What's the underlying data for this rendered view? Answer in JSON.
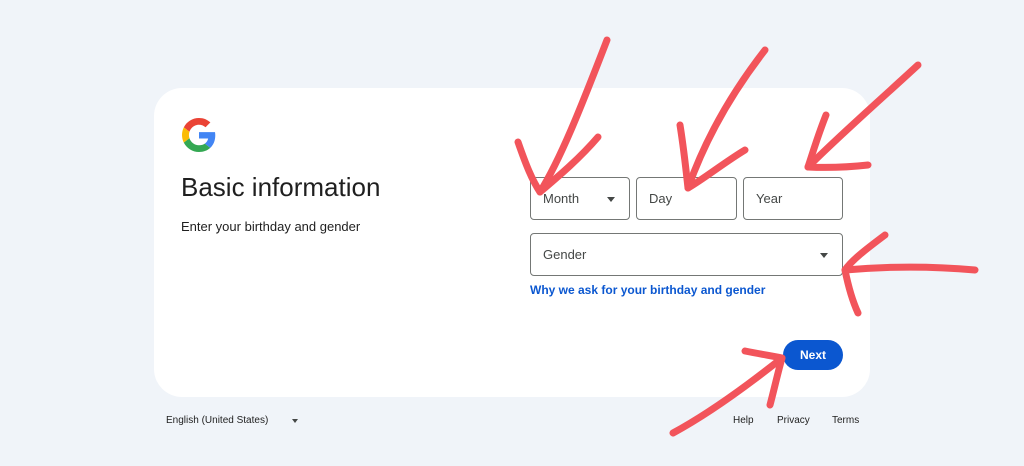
{
  "header": {
    "logo": "google-g-logo",
    "title": "Basic information",
    "subtitle": "Enter your birthday and gender"
  },
  "form": {
    "month_label": "Month",
    "day_label": "Day",
    "year_label": "Year",
    "gender_label": "Gender",
    "why_link": "Why we ask for your birthday and gender",
    "next_label": "Next"
  },
  "footer": {
    "language": "English (United States)",
    "links": [
      "Help",
      "Privacy",
      "Terms"
    ]
  },
  "colors": {
    "background": "#f0f4f9",
    "primary": "#0b57d0",
    "annotation": "#f2545b"
  }
}
